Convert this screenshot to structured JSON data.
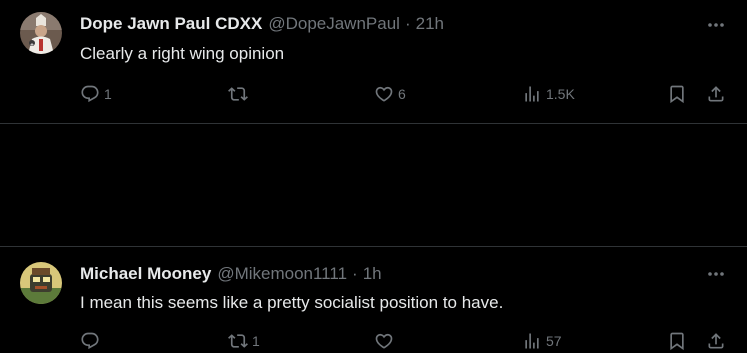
{
  "tweets": [
    {
      "author_name": "Dope Jawn Paul CDXX",
      "handle": "@DopeJawnPaul",
      "separator": "·",
      "time": "21h",
      "text": "Clearly a right wing opinion",
      "replies": "1",
      "retweets": "",
      "likes": "6",
      "views": "1.5K",
      "avatar_icon": "pope-avatar"
    },
    {
      "author_name": "Michael Mooney",
      "handle": "@Mikemoon1111",
      "separator": "·",
      "time": "1h",
      "text": "I mean this seems like a pretty socialist position to have.",
      "replies": "",
      "retweets": "1",
      "likes": "",
      "views": "57",
      "avatar_icon": "cartoon-avatar"
    }
  ],
  "colors": {
    "background": "#000000",
    "primary_text": "#e7e9ea",
    "secondary_text": "#71767b",
    "divider": "#2f3336"
  }
}
